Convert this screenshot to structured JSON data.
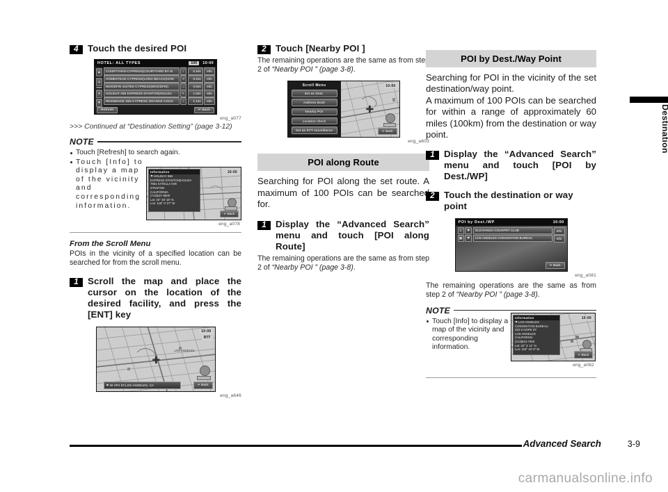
{
  "footer": {
    "section_title": "Advanced Search",
    "page_number": "3-9",
    "watermark": "carmanualsonline.info"
  },
  "side_tab": {
    "label": "Destination"
  },
  "column_left": {
    "step4": {
      "num": "4",
      "text": "Touch the desired POI"
    },
    "fig_a077": {
      "caption": "eng_a077",
      "header_title": "HOTEL:  ALL  TYPES",
      "header_count": "100",
      "header_clock": "10:00",
      "rows": [
        {
          "name": "COURTYARD-CYPRESS(COURTYARD BY M",
          "dir": "↑",
          "dist": "0.4mi",
          "info": "Info"
        },
        {
          "name": "HOMESTEAD-CYPRESS(LONG BEACH(HOM",
          "dir": "↗",
          "dist": "0.4mi",
          "info": "Info"
        },
        {
          "name": "WOODFIN SUITES-CYPRESS(WOODFIN)",
          "dir": "→",
          "dist": "0.5mi",
          "info": "Info"
        },
        {
          "name": "HOLIDAY INN EXPRESS-STANTON(HOLIDA",
          "dir": "↖",
          "dist": "1.0mi",
          "info": "Info"
        },
        {
          "name": "RESIDENCE INN-CYPRESS ORANGE COUN",
          "dir": "↑",
          "dist": "1.1mi",
          "info": "Info"
        }
      ],
      "refresh_label": "Refresh",
      "back_label": "↵ Back"
    },
    "continued": ">>> Continued at “Destination Setting” (page 3-12)",
    "note_label": "NOTE",
    "note_items": [
      "Touch [Refresh] to search again.",
      "Touch [Info] to display a map of the vicinity and corresponding information."
    ],
    "fig_a078": {
      "caption": "eng_a078",
      "clock": "10:00",
      "panel_title": "Information",
      "panel_lines": [
        "⚑ HOLIDAY INN",
        "     EXPRESS-STANTON(HOLIDA",
        "7961 KATELLA AVE",
        "STANTON",
        "CALIFORNIA",
        "(714)527-6600",
        "Lat:   33° 48′ 16″ N",
        "Lon: 118°  0′ 27″ W"
      ],
      "back_label": "↵ Back"
    },
    "subhead": "From the Scroll Menu",
    "subhead_body": "POIs in the vicinity of a specified location can be searched for from the scroll menu.",
    "step1": {
      "num": "1",
      "text": "Scroll the map and place the cursor on the location of the desired facility, and press the [ENT] key"
    },
    "fig_a646": {
      "caption": "eng_a646",
      "clock": "10:00",
      "rtt": "RTT",
      "poi_label": "LOS ANGELES",
      "address": "⚑ W 4TH ST,LOS  ANGELES, CA",
      "back_label": "↵ Back"
    }
  },
  "column_middle": {
    "step2": {
      "num": "2",
      "text": "Touch [Nearby POI ]"
    },
    "step2_body_a": "The remaining operations are the same as from step 2",
    "step2_body_b": "of ",
    "step2_body_ital": "“Nearby POI ” (page 3-8)",
    "step2_body_end": ".",
    "fig_a603": {
      "caption": "eng_a603",
      "menu_title": "Scroll  Menu",
      "clock": "10:00",
      "menu_items": [
        "Set as Dest.",
        "Address Book",
        "Nearby POI",
        "Location check",
        "Set as RTT surveillance"
      ],
      "back_label": "↵ Back"
    },
    "banner": "POI along Route",
    "banner_body": "Searching for POI along the set route. A maximum of 100 POIs can be searched for.",
    "step1": {
      "num": "1",
      "text": "Display the “Advanced Search” menu and touch [POI along Route]"
    },
    "step1_body_a": "The remaining operations are the same as from step 2",
    "step1_body_b": "of ",
    "step1_body_ital": "“Nearby POI ” (page 3-8)",
    "step1_body_end": "."
  },
  "column_right": {
    "banner": "POI by Dest./Way Point",
    "banner_body": "Searching for POI in the vicinity of the set destination/way point.\nA maximum of 100 POIs can be searched for within a range of approximately 60 miles (100km) from the destination or way point.",
    "step1": {
      "num": "1",
      "text": "Display the “Advanced Search” menu and touch [POI by Dest./WP]"
    },
    "step2": {
      "num": "2",
      "text": "Touch the destination or way point"
    },
    "fig_a081": {
      "caption": "eng_a081",
      "title": "POI by Dest./WP",
      "clock": "10:00",
      "rows": [
        {
          "num": "1",
          "icon": "⚑",
          "name": "OLD RANCH COUNTRY CLUB",
          "info": "Info"
        },
        {
          "num": "▦",
          "icon": "⚑",
          "name": "LOS ANGELES CONVENTION BUREAU",
          "info": "Info"
        }
      ],
      "back_label": "↵ Back"
    },
    "after_body_a": "The remaining operations are the same as from step 2",
    "after_body_b": "of ",
    "after_body_ital": "“Nearby POI ” (page 3-8)",
    "after_body_end": ".",
    "note_label": "NOTE",
    "note_items": [
      "Touch [Info] to display a map of the vicinity and corresponding information."
    ],
    "fig_a082": {
      "caption": "eng_a082",
      "clock": "10:00",
      "panel_title": "Information",
      "panel_lines": [
        "⚑ LOS  ANGELES",
        "      CONVENTION BUREAU",
        "333  S HOPE ST",
        "LOS  ANGELES",
        "CALIFORNIA",
        "(213)624-7300",
        "Lat:    34°  3′ 11″ N",
        "Lon: 118° 15′  0″ W"
      ],
      "back_label": "↵ Back"
    }
  }
}
